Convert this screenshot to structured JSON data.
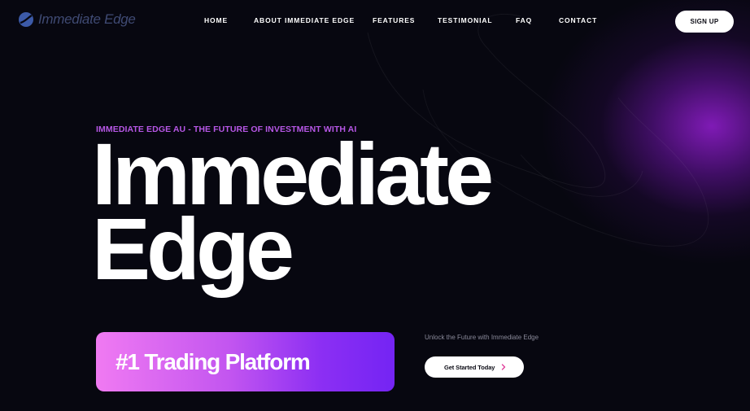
{
  "brand": {
    "name": "Immediate Edge",
    "accent": "#b757e6",
    "badge_gradient": [
      "#f07af2",
      "#7424f3"
    ]
  },
  "nav": {
    "items": [
      {
        "label": "HOME"
      },
      {
        "label": "ABOUT IMMEDIATE EDGE"
      },
      {
        "label": "FEATURES"
      },
      {
        "label": "TESTIMONIAL"
      },
      {
        "label": "FAQ"
      },
      {
        "label": "CONTACT"
      }
    ],
    "signup_label": "SIGN UP"
  },
  "hero": {
    "eyebrow": "IMMEDIATE EDGE AU - THE FUTURE OF INVESTMENT WITH AI",
    "title_line1": "Immediate",
    "title_line2": "Edge",
    "badge": "#1 Trading Platform",
    "tagline": "Unlock the Future with Immediate Edge",
    "cta_label": "Get Started Today",
    "cta_icon": "chevron-right-icon"
  }
}
